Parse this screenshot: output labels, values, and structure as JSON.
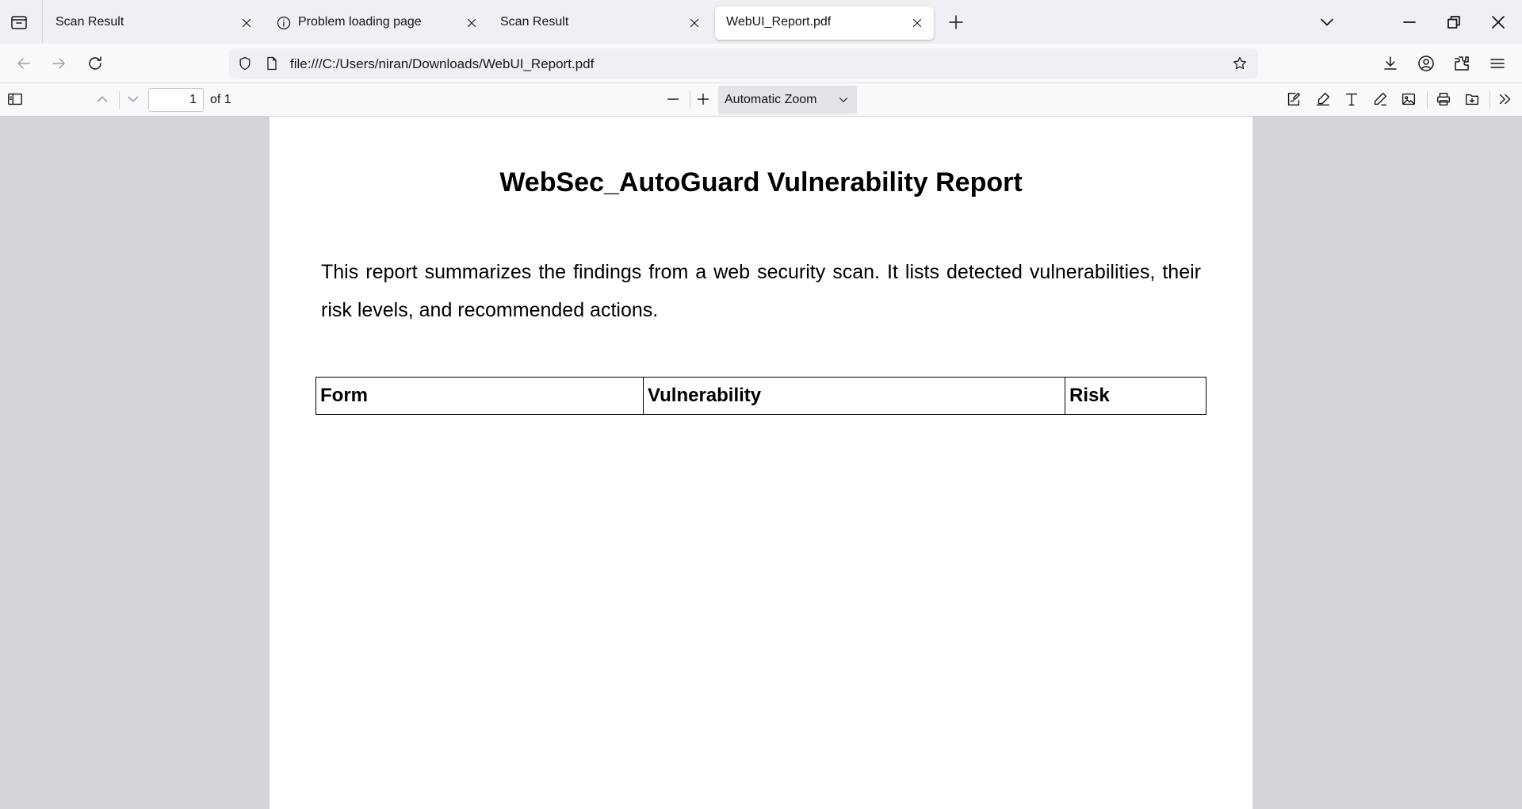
{
  "browser": {
    "tabs": [
      {
        "title": "Scan Result",
        "active": false,
        "icon": null
      },
      {
        "title": "Problem loading page",
        "active": false,
        "icon": "info-icon"
      },
      {
        "title": "Scan Result",
        "active": false,
        "icon": null
      },
      {
        "title": "WebUI_Report.pdf",
        "active": true,
        "icon": null
      }
    ],
    "url": "file:///C:/Users/niran/Downloads/WebUI_Report.pdf"
  },
  "pdf_toolbar": {
    "page_number": "1",
    "page_count": "of 1",
    "zoom": "Automatic Zoom"
  },
  "document": {
    "title": "WebSec_AutoGuard Vulnerability Report",
    "intro": "This report summarizes the findings from a web security scan. It lists detected vulnerabilities, their risk levels, and recommended actions.",
    "table": {
      "headers": [
        "Form",
        "Vulnerability",
        "Risk"
      ]
    }
  }
}
